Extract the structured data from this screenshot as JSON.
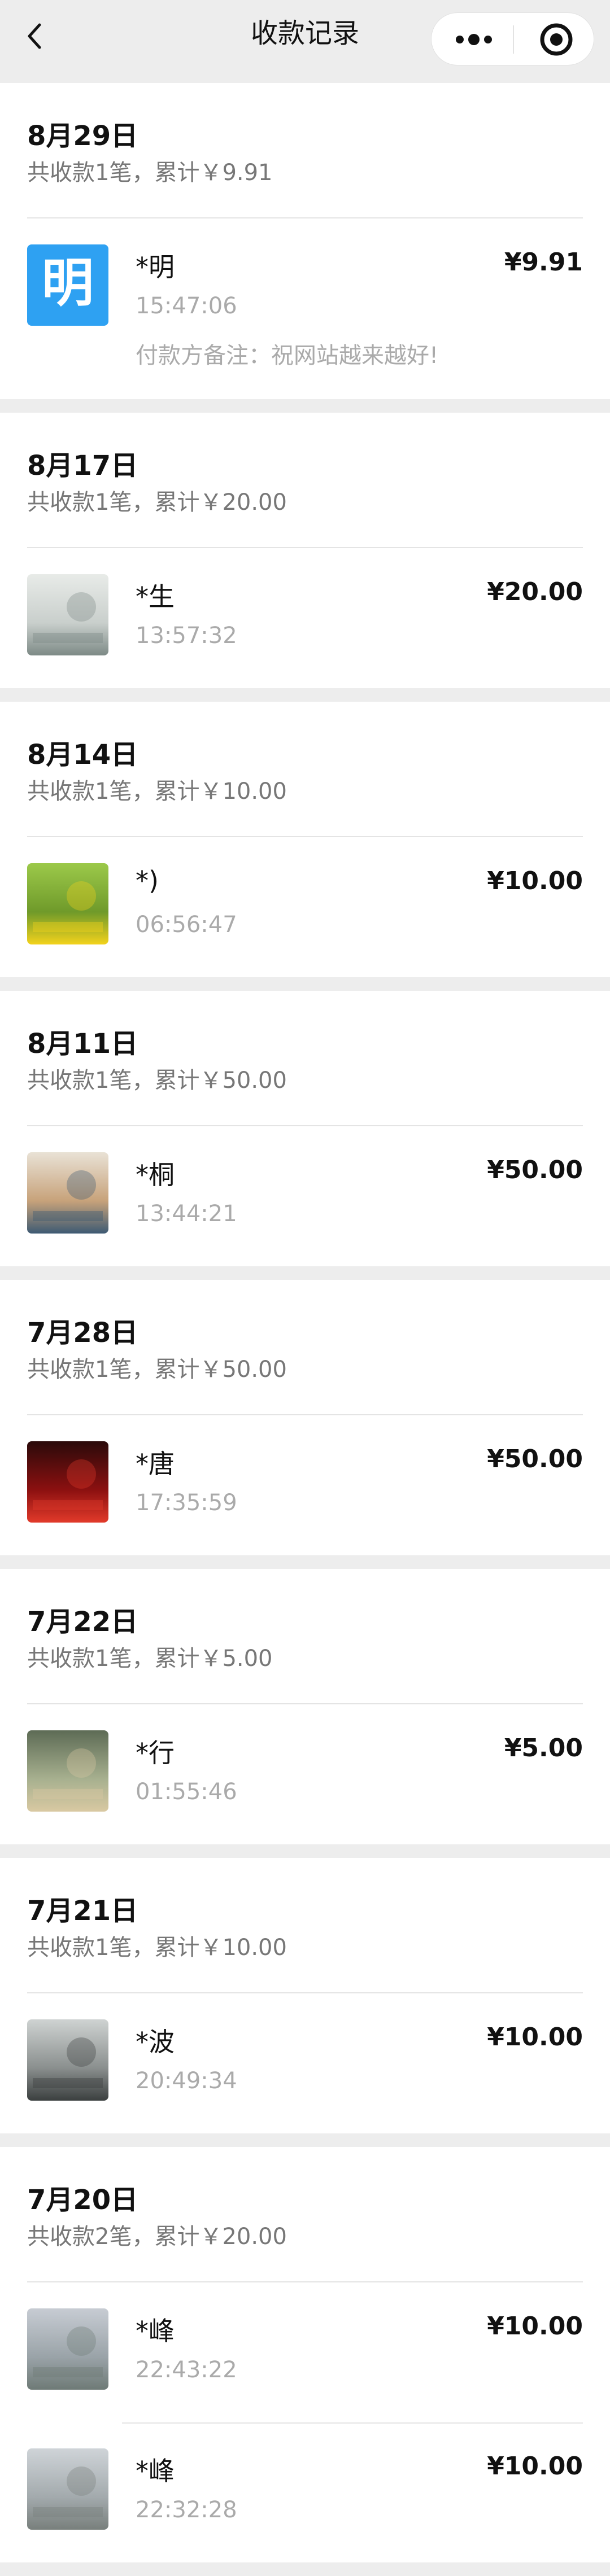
{
  "nav": {
    "title": "收款记录"
  },
  "groups": [
    {
      "date": "8月29日",
      "summary": "共收款1笔，累计￥9.91",
      "records": [
        {
          "name": "*明",
          "time": "15:47:06",
          "amount": "¥9.91",
          "note": "付款方备注：祝网站越来越好!",
          "avatar_type": "text",
          "avatar_text": "明",
          "avatar_colors": [
            "#2ea1f2",
            "#2ea1f2"
          ]
        }
      ]
    },
    {
      "date": "8月17日",
      "summary": "共收款1笔，累计￥20.00",
      "records": [
        {
          "name": "*生",
          "time": "13:57:32",
          "amount": "¥20.00",
          "avatar_type": "photo",
          "avatar_colors": [
            "#e8ebe8",
            "#c9cfcc",
            "#7d8a86"
          ]
        }
      ]
    },
    {
      "date": "8月14日",
      "summary": "共收款1笔，累计￥10.00",
      "records": [
        {
          "name": "*)",
          "time": "06:56:47",
          "amount": "¥10.00",
          "avatar_type": "photo",
          "avatar_colors": [
            "#9cc94a",
            "#6f9a2a",
            "#f3d21c"
          ]
        }
      ]
    },
    {
      "date": "8月11日",
      "summary": "共收款1笔，累计￥50.00",
      "records": [
        {
          "name": "*桐",
          "time": "13:44:21",
          "amount": "¥50.00",
          "avatar_type": "photo",
          "avatar_colors": [
            "#e9e2d6",
            "#c7a27a",
            "#3d5a73"
          ]
        }
      ]
    },
    {
      "date": "7月28日",
      "summary": "共收款1笔，累计￥50.00",
      "records": [
        {
          "name": "*唐",
          "time": "17:35:59",
          "amount": "¥50.00",
          "avatar_type": "photo",
          "avatar_colors": [
            "#2a0a0a",
            "#8c1010",
            "#e23a2a"
          ]
        }
      ]
    },
    {
      "date": "7月22日",
      "summary": "共收款1笔，累计￥5.00",
      "records": [
        {
          "name": "*行",
          "time": "01:55:46",
          "amount": "¥5.00",
          "avatar_type": "photo",
          "avatar_colors": [
            "#5d6b55",
            "#a7b08f",
            "#d9c9a2"
          ]
        }
      ]
    },
    {
      "date": "7月21日",
      "summary": "共收款1笔，累计￥10.00",
      "records": [
        {
          "name": "*波",
          "time": "20:49:34",
          "amount": "¥10.00",
          "avatar_type": "photo",
          "avatar_colors": [
            "#cfd3d2",
            "#8a8f8e",
            "#3b3f3f"
          ]
        }
      ]
    },
    {
      "date": "7月20日",
      "summary": "共收款2笔，累计￥20.00",
      "records": [
        {
          "name": "*峰",
          "time": "22:43:22",
          "amount": "¥10.00",
          "avatar_type": "photo",
          "avatar_colors": [
            "#c7ccd3",
            "#9aa3a8",
            "#6e7a76"
          ]
        },
        {
          "name": "*峰",
          "time": "22:32:28",
          "amount": "¥10.00",
          "avatar_type": "photo",
          "avatar_colors": [
            "#cfd4d8",
            "#a3aaad",
            "#787f7c"
          ]
        }
      ]
    }
  ]
}
